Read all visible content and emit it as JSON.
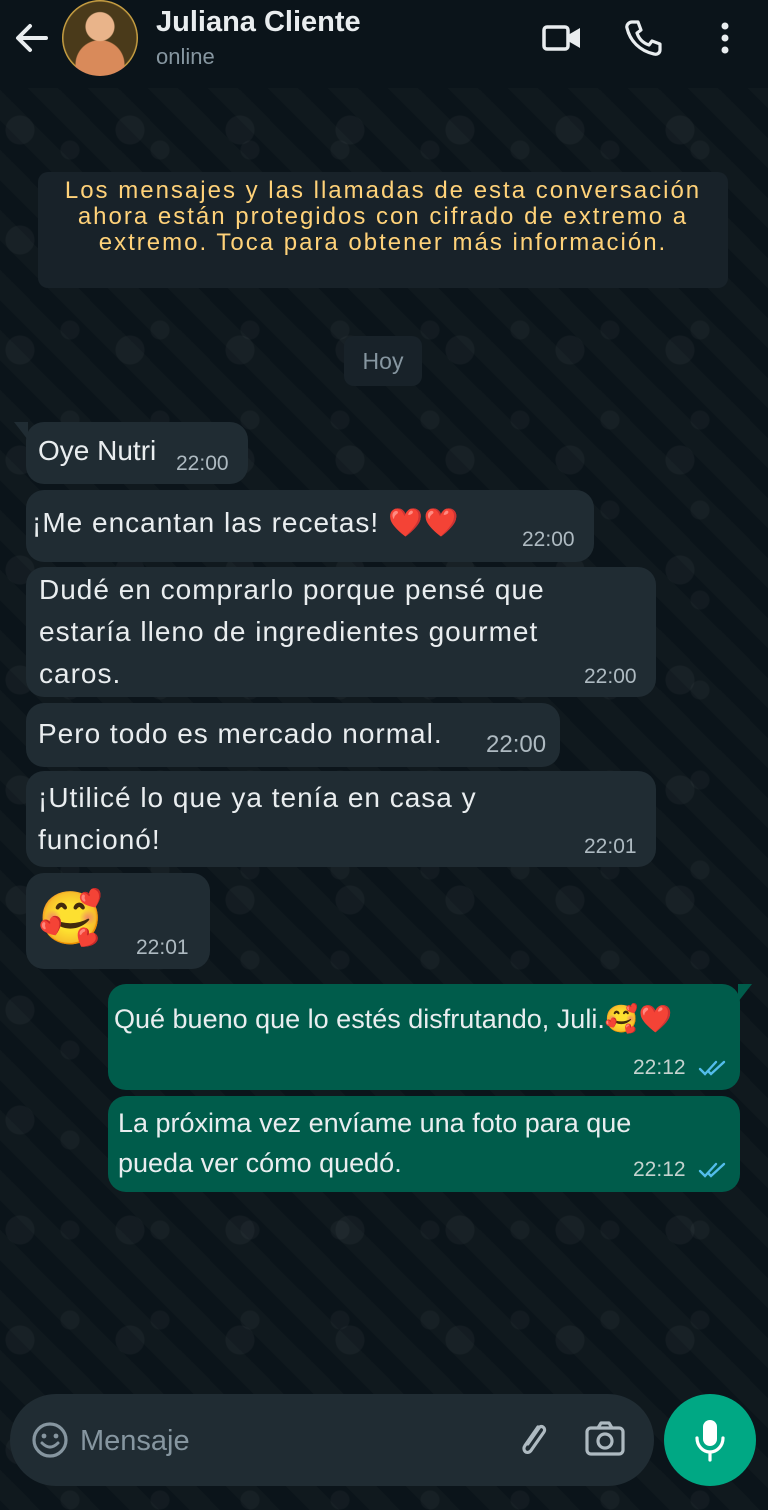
{
  "header": {
    "contact_name": "Juliana Cliente",
    "status": "online"
  },
  "chat": {
    "encryption_notice": "Los mensajes y las llamadas de esta conversación ahora están protegidos con cifrado de extremo a extremo. Toca para obtener más información.",
    "date_label": "Hoy",
    "messages": [
      {
        "direction": "in",
        "text": "Oye Nutri",
        "time": "22:00"
      },
      {
        "direction": "in",
        "text": "¡Me encantan las recetas! ❤️❤️",
        "time": "22:00"
      },
      {
        "direction": "in",
        "text_lines": [
          "Dudé en comprarlo porque pensé que",
          "estaría lleno de ingredientes gourmet",
          "caros."
        ],
        "time": "22:00"
      },
      {
        "direction": "in",
        "text": "Pero todo es mercado normal.",
        "time": "22:00"
      },
      {
        "direction": "in",
        "text_lines": [
          "¡Utilicé lo que ya tenía en casa y",
          "funcionó!"
        ],
        "time": "22:01"
      },
      {
        "direction": "in",
        "text": "🥰",
        "time": "22:01"
      },
      {
        "direction": "out",
        "text": "Qué bueno que lo estés disfrutando, Juli.🥰❤️",
        "time": "22:12",
        "status": "read"
      },
      {
        "direction": "out",
        "text_lines": [
          "La próxima vez envíame una foto para que",
          "pueda ver cómo quedó."
        ],
        "time": "22:12",
        "status": "read"
      }
    ]
  },
  "composer": {
    "placeholder": "Mensaje"
  },
  "icons": {
    "back": "arrow-left",
    "video": "video-camera",
    "call": "phone",
    "menu": "more-vertical",
    "emoji": "smiley",
    "attach": "paperclip",
    "camera": "camera",
    "mic": "microphone"
  },
  "colors": {
    "background": "#0b141a",
    "incoming_bubble": "#202c33",
    "outgoing_bubble": "#005c4b",
    "notice_text": "#ffd279",
    "accent": "#00a884",
    "read_ticks": "#53bdeb"
  }
}
